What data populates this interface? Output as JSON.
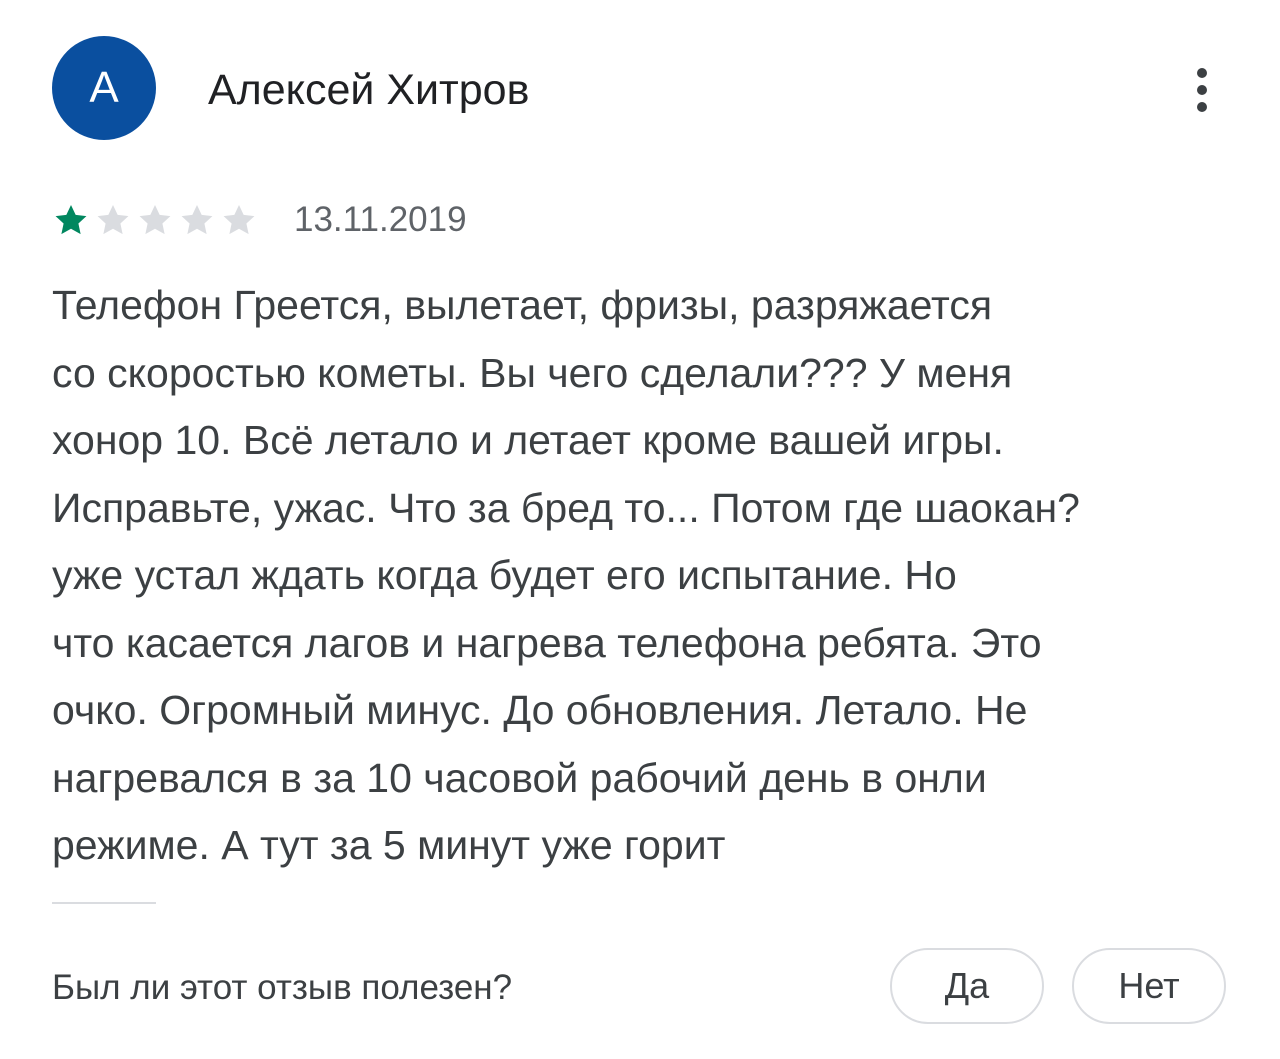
{
  "review": {
    "avatar_letter": "А",
    "avatar_color": "#0a4f9f",
    "author": "Алексей Хитров",
    "rating": 1,
    "max_rating": 5,
    "star_filled_color": "#01875f",
    "star_empty_color": "#dadce0",
    "date": "13.11.2019",
    "text_lines": [
      "Телефон Греется, вылетает, фризы, разряжается",
      "со скоростью кометы. Вы чего сделали??? У меня",
      "хонор 10. Всё летало и летает кроме вашей игры.",
      "Исправьте, ужас. Что за бред то... Потом где шаокан?",
      "уже устал ждать когда будет его испытание. Но",
      "что касается лагов и нагрева телефона ребята. Это",
      "очко. Огромный минус. До обновления. Летало. Не",
      "нагревался в за 10 часовой рабочий день в онли",
      "режиме. А тут за 5 минут уже горит"
    ]
  },
  "menu": {
    "icon": "more-vert-icon"
  },
  "feedback": {
    "question": "Был ли этот отзыв полезен?",
    "yes_label": "Да",
    "no_label": "Нет"
  }
}
